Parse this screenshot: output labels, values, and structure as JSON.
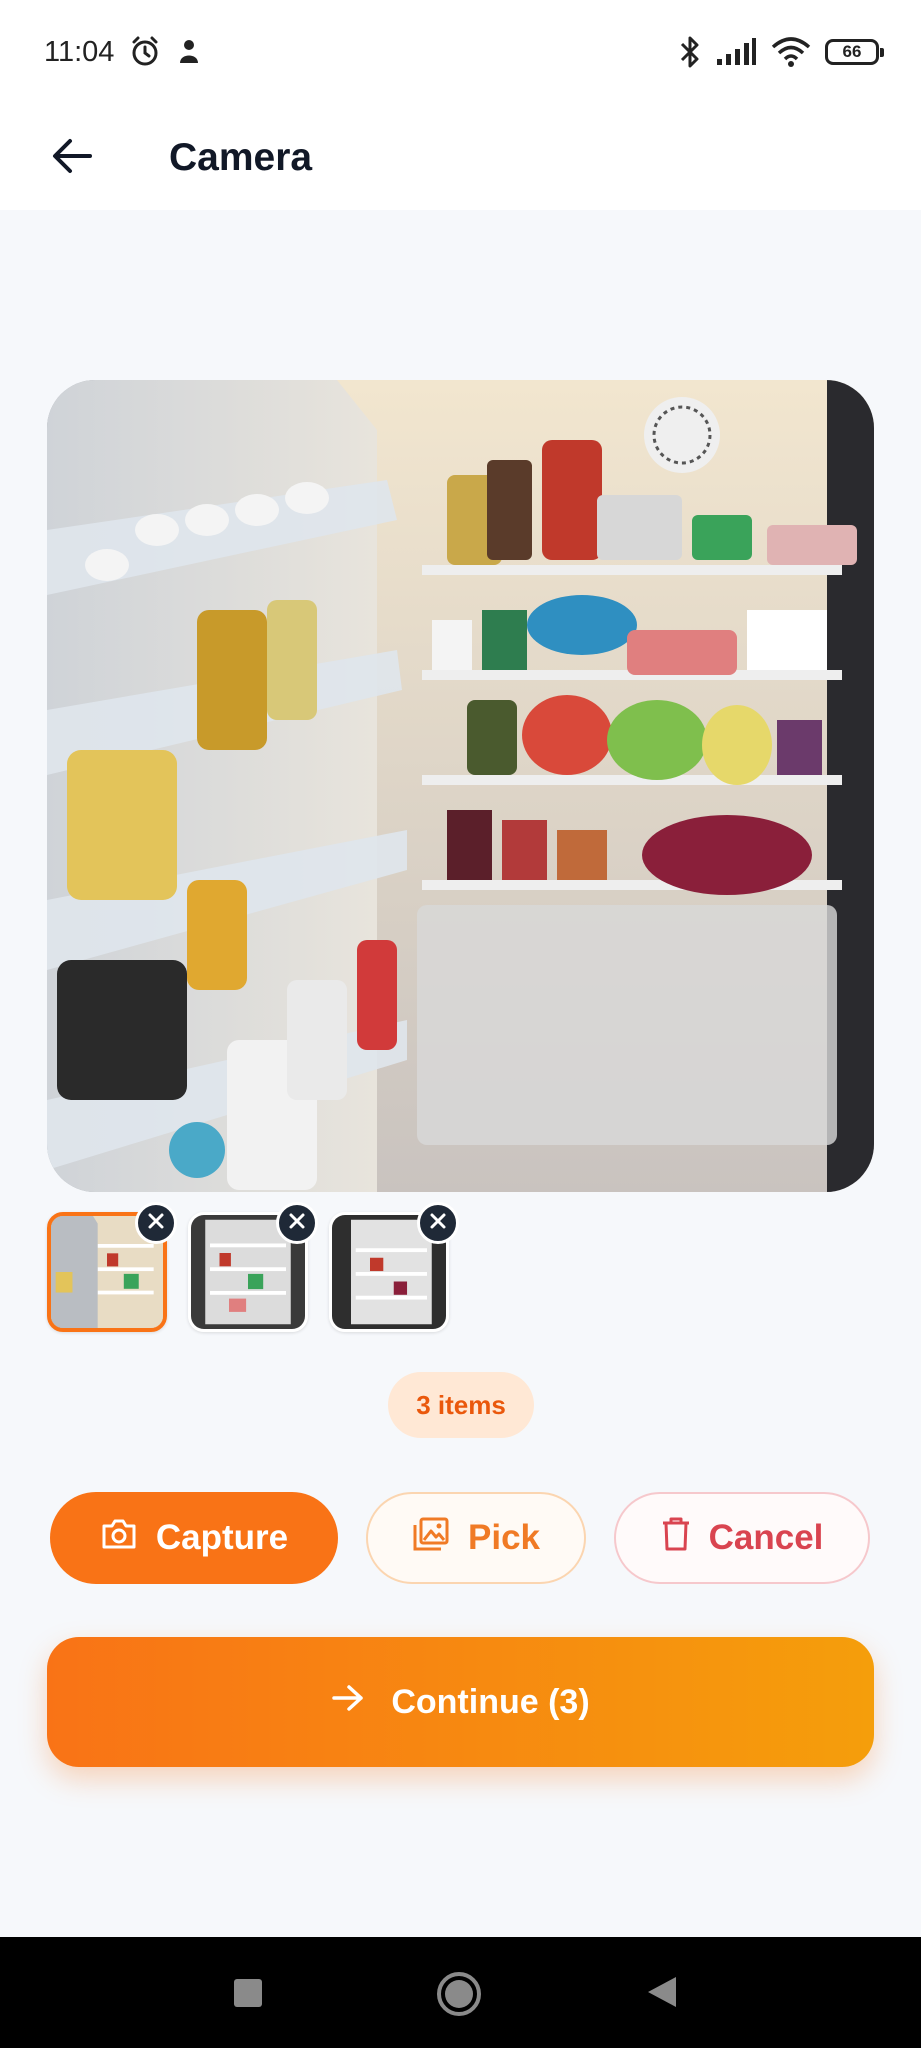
{
  "status_bar": {
    "time": "11:04",
    "battery": "66",
    "icons": [
      "alarm-icon",
      "notification-icon",
      "bluetooth-icon",
      "signal-icon",
      "wifi-icon",
      "battery-icon"
    ]
  },
  "app_bar": {
    "title": "Camera",
    "back_icon": "arrow-left-icon"
  },
  "preview": {
    "description_icon": "photo-preview"
  },
  "thumbnails": [
    {
      "selected": true,
      "remove_icon": "close-icon"
    },
    {
      "selected": false,
      "remove_icon": "close-icon"
    },
    {
      "selected": false,
      "remove_icon": "close-icon"
    }
  ],
  "count_pill": "3 items",
  "actions": {
    "capture": {
      "label": "Capture",
      "icon": "camera-icon"
    },
    "pick": {
      "label": "Pick",
      "icon": "image-icon"
    },
    "cancel": {
      "label": "Cancel",
      "icon": "trash-icon"
    }
  },
  "continue_button": {
    "label": "Continue (3)",
    "icon": "arrow-right-icon"
  },
  "nav_bar": {
    "icons": [
      "recents-icon",
      "home-icon",
      "back-icon"
    ]
  },
  "colors": {
    "accent": "#f97316",
    "accent_end": "#f59e0b",
    "danger": "#d94450",
    "pill_bg": "#ffe8d5"
  }
}
